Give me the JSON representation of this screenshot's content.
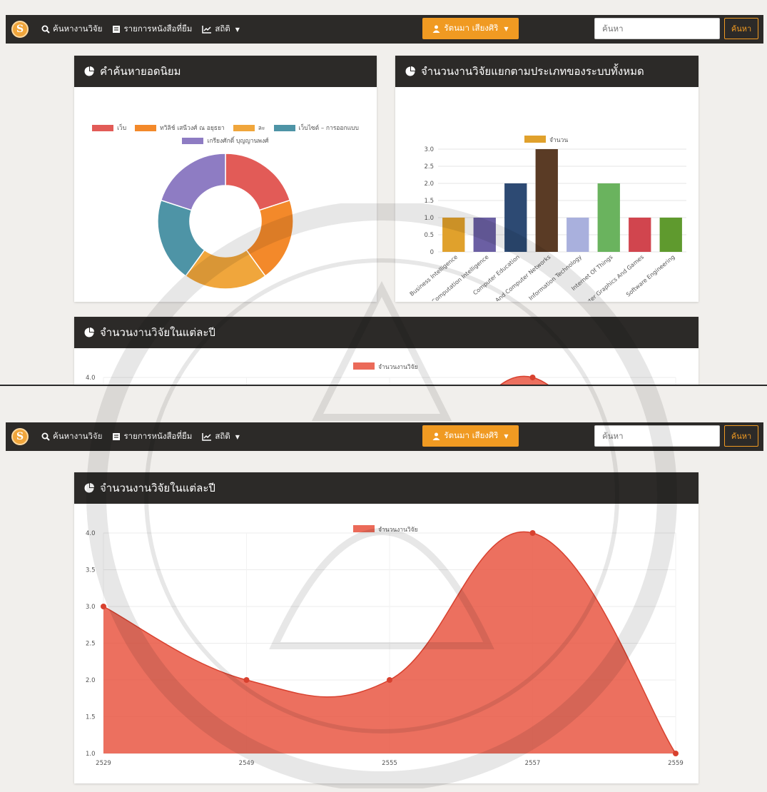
{
  "nav": {
    "logo": "S",
    "links": [
      {
        "icon": "search-icon",
        "glyph": "🔍",
        "label": "ค้นหางานวิจัย"
      },
      {
        "icon": "book-icon",
        "glyph": "▤",
        "label": "รายการหนังสือที่ยืม"
      },
      {
        "icon": "chart-line-icon",
        "glyph": "📈",
        "label": "สถิติ"
      }
    ],
    "user": "รัตนมา เสียงศิริ",
    "search_placeholder": "ค้นหา",
    "search_button": "ค้นหา"
  },
  "panels": {
    "popular": {
      "title": "คำค้นหายอดนิยม"
    },
    "by_type": {
      "title": "จำนวนงานวิจัยแยกตามประเภทของระบบทั้งหมด"
    },
    "per_year": {
      "title": "จำนวนงานวิจัยในแต่ละปี"
    }
  },
  "chart_data": [
    {
      "type": "pie",
      "variant": "doughnut",
      "labels": [
        "เว็บ",
        "ทวิลิช์ เสนีวงศ์ ณ อยุธยา",
        "ละ",
        "เว็บไซต์ – การออกแบบ",
        "เกรียงศักดิ์ บุญญานพงศ์"
      ],
      "values": [
        1,
        1,
        1,
        1,
        1
      ],
      "colors": [
        "#e25b57",
        "#f3892a",
        "#f0a63c",
        "#4e94a6",
        "#8e7cc3"
      ],
      "legend": "top"
    },
    {
      "type": "bar",
      "categories": [
        "Business Intelligence",
        "Computation Intelligence",
        "Computer Education",
        "Computer Systems And Computer Networks",
        "Information Technology",
        "Internet Of Things",
        "Multimedia, Computer Graphics And Games",
        "Software Engineering"
      ],
      "series": [
        {
          "name": "จำนวน",
          "values": [
            1,
            1,
            2,
            3,
            1,
            2,
            1,
            1
          ]
        }
      ],
      "colors": [
        "#e0a12c",
        "#6b5fa3",
        "#2d4a73",
        "#5a3b25",
        "#a9b0dd",
        "#6ab35e",
        "#d1454e",
        "#5f9a2e"
      ],
      "legend_color": "#e0a12c",
      "ylim": [
        0,
        3
      ],
      "yticks": [
        "0",
        "0.5",
        "1.0",
        "1.5",
        "2.0",
        "2.5",
        "3.0"
      ],
      "legend": "top",
      "grid": true
    },
    {
      "type": "area",
      "x": [
        "2529",
        "2549",
        "2555",
        "2557",
        "2559"
      ],
      "series": [
        {
          "name": "จำนวนงานวิจัย",
          "values": [
            3,
            2,
            2,
            4,
            1
          ]
        }
      ],
      "color": "#e8503c",
      "ylim": [
        1,
        4
      ],
      "yticks": [
        "1.0",
        "1.5",
        "2.0",
        "2.5",
        "3.0",
        "3.5",
        "4.0"
      ],
      "legend": "top",
      "grid": true
    }
  ]
}
